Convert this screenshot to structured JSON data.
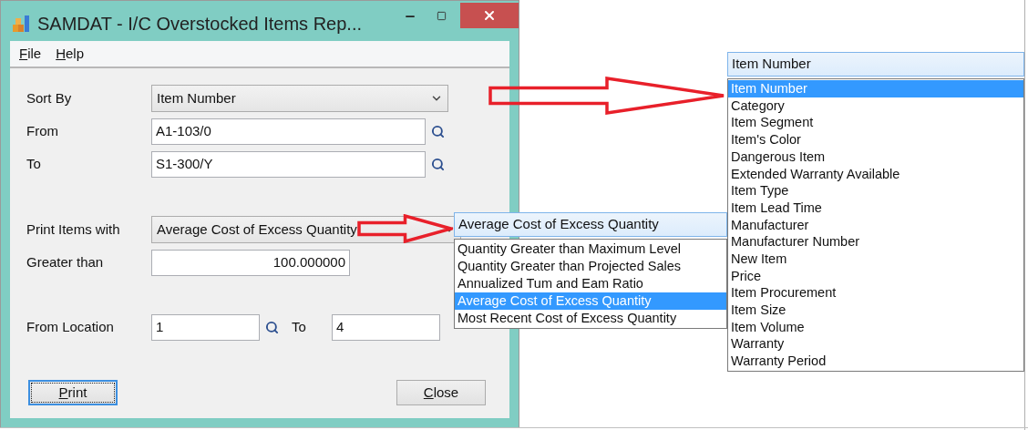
{
  "window": {
    "title": "SAMDAT - I/C Overstocked Items Rep..."
  },
  "menu": [
    "File",
    "Help"
  ],
  "sort_by": {
    "label": "Sort By",
    "value": "Item Number"
  },
  "from": {
    "label": "From",
    "value": "A1-103/0"
  },
  "to": {
    "label": "To",
    "value": "S1-300/Y"
  },
  "print_items_with": {
    "label": "Print Items with",
    "value": "Average Cost of Excess Quantity"
  },
  "greater_than": {
    "label": "Greater than",
    "value": "100.000000"
  },
  "location": {
    "label": "From Location",
    "from": "1",
    "to_label": "To",
    "to": "4"
  },
  "buttons": [
    {
      "label": "Print",
      "focused": true
    },
    {
      "label": "Close",
      "focused": false
    }
  ],
  "print_items_dropdown": {
    "value": "Average Cost of Excess Quantity",
    "options": [
      {
        "label": "Quantity Greater than Maximum Level",
        "selected": false
      },
      {
        "label": "Quantity Greater than Projected Sales",
        "selected": false
      },
      {
        "label": "Annualized Tum and Eam Ratio",
        "selected": false
      },
      {
        "label": "Average Cost of Excess Quantity",
        "selected": true
      },
      {
        "label": "Most Recent Cost of Excess Quantity",
        "selected": false
      }
    ]
  },
  "sort_by_dropdown": {
    "value": "Item Number",
    "options": [
      {
        "label": "Item Number",
        "selected": true
      },
      {
        "label": "Category",
        "selected": false
      },
      {
        "label": "Item Segment",
        "selected": false
      },
      {
        "label": "Item's Color",
        "selected": false
      },
      {
        "label": "Dangerous Item",
        "selected": false
      },
      {
        "label": "Extended Warranty Available",
        "selected": false
      },
      {
        "label": "Item Type",
        "selected": false
      },
      {
        "label": "Item Lead Time",
        "selected": false
      },
      {
        "label": "Manufacturer",
        "selected": false
      },
      {
        "label": "Manufacturer Number",
        "selected": false
      },
      {
        "label": "New Item",
        "selected": false
      },
      {
        "label": "Price",
        "selected": false
      },
      {
        "label": "Item Procurement",
        "selected": false
      },
      {
        "label": "Item Size",
        "selected": false
      },
      {
        "label": "Item Volume",
        "selected": false
      },
      {
        "label": "Warranty",
        "selected": false
      },
      {
        "label": "Warranty Period",
        "selected": false
      }
    ]
  }
}
